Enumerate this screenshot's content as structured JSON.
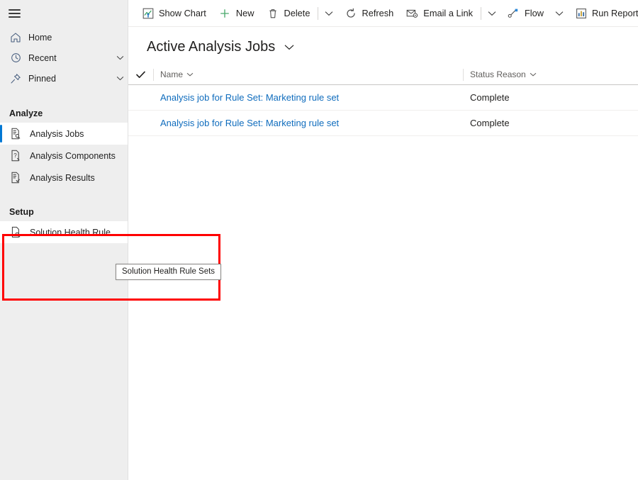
{
  "sidebar": {
    "menu_icon": "hamburger-icon",
    "nav": [
      {
        "label": "Home",
        "icon": "home-icon",
        "chevron": false
      },
      {
        "label": "Recent",
        "icon": "clock-icon",
        "chevron": true
      },
      {
        "label": "Pinned",
        "icon": "pin-icon",
        "chevron": true
      }
    ],
    "groups": [
      {
        "title": "Analyze",
        "items": [
          {
            "label": "Analysis Jobs",
            "icon": "document-search-icon",
            "selected": true
          },
          {
            "label": "Analysis Components",
            "icon": "document-question-icon",
            "selected": false
          },
          {
            "label": "Analysis Results",
            "icon": "document-check-icon",
            "selected": false
          }
        ]
      },
      {
        "title": "Setup",
        "items": [
          {
            "label": "Solution Health Rule ...",
            "icon": "document-magnify-icon",
            "selected": false,
            "hovered": true
          }
        ]
      }
    ]
  },
  "tooltip": {
    "text": "Solution Health Rule Sets"
  },
  "commandbar": {
    "items": [
      {
        "type": "button",
        "label": "Show Chart",
        "icon": "show-chart-icon"
      },
      {
        "type": "button",
        "label": "New",
        "icon": "plus-icon"
      },
      {
        "type": "button",
        "label": "Delete",
        "icon": "trash-icon"
      },
      {
        "type": "separator"
      },
      {
        "type": "chevron",
        "icon": "chevron-down-icon"
      },
      {
        "type": "button",
        "label": "Refresh",
        "icon": "refresh-icon"
      },
      {
        "type": "button",
        "label": "Email a Link",
        "icon": "email-link-icon"
      },
      {
        "type": "separator"
      },
      {
        "type": "chevron",
        "icon": "chevron-down-icon"
      },
      {
        "type": "button",
        "label": "Flow",
        "icon": "flow-icon"
      },
      {
        "type": "chevron",
        "icon": "chevron-down-icon"
      },
      {
        "type": "button",
        "label": "Run Report",
        "icon": "run-report-icon"
      },
      {
        "type": "chevron",
        "icon": "chevron-down-icon"
      }
    ]
  },
  "view": {
    "title": "Active Analysis Jobs",
    "title_chevron": "chevron-down-icon"
  },
  "grid": {
    "columns": [
      {
        "key": "name",
        "label": "Name"
      },
      {
        "key": "status_reason",
        "label": "Status Reason"
      }
    ],
    "select_all_icon": "checkmark-icon",
    "rows": [
      {
        "name": "Analysis job for Rule Set: Marketing rule set",
        "status_reason": "Complete"
      },
      {
        "name": "Analysis job for Rule Set: Marketing rule set",
        "status_reason": "Complete"
      }
    ]
  },
  "colors": {
    "accent": "#0078d4",
    "link": "#0f6cbd",
    "highlight": "#ff0000",
    "sidebar_bg": "#eeeeee"
  }
}
